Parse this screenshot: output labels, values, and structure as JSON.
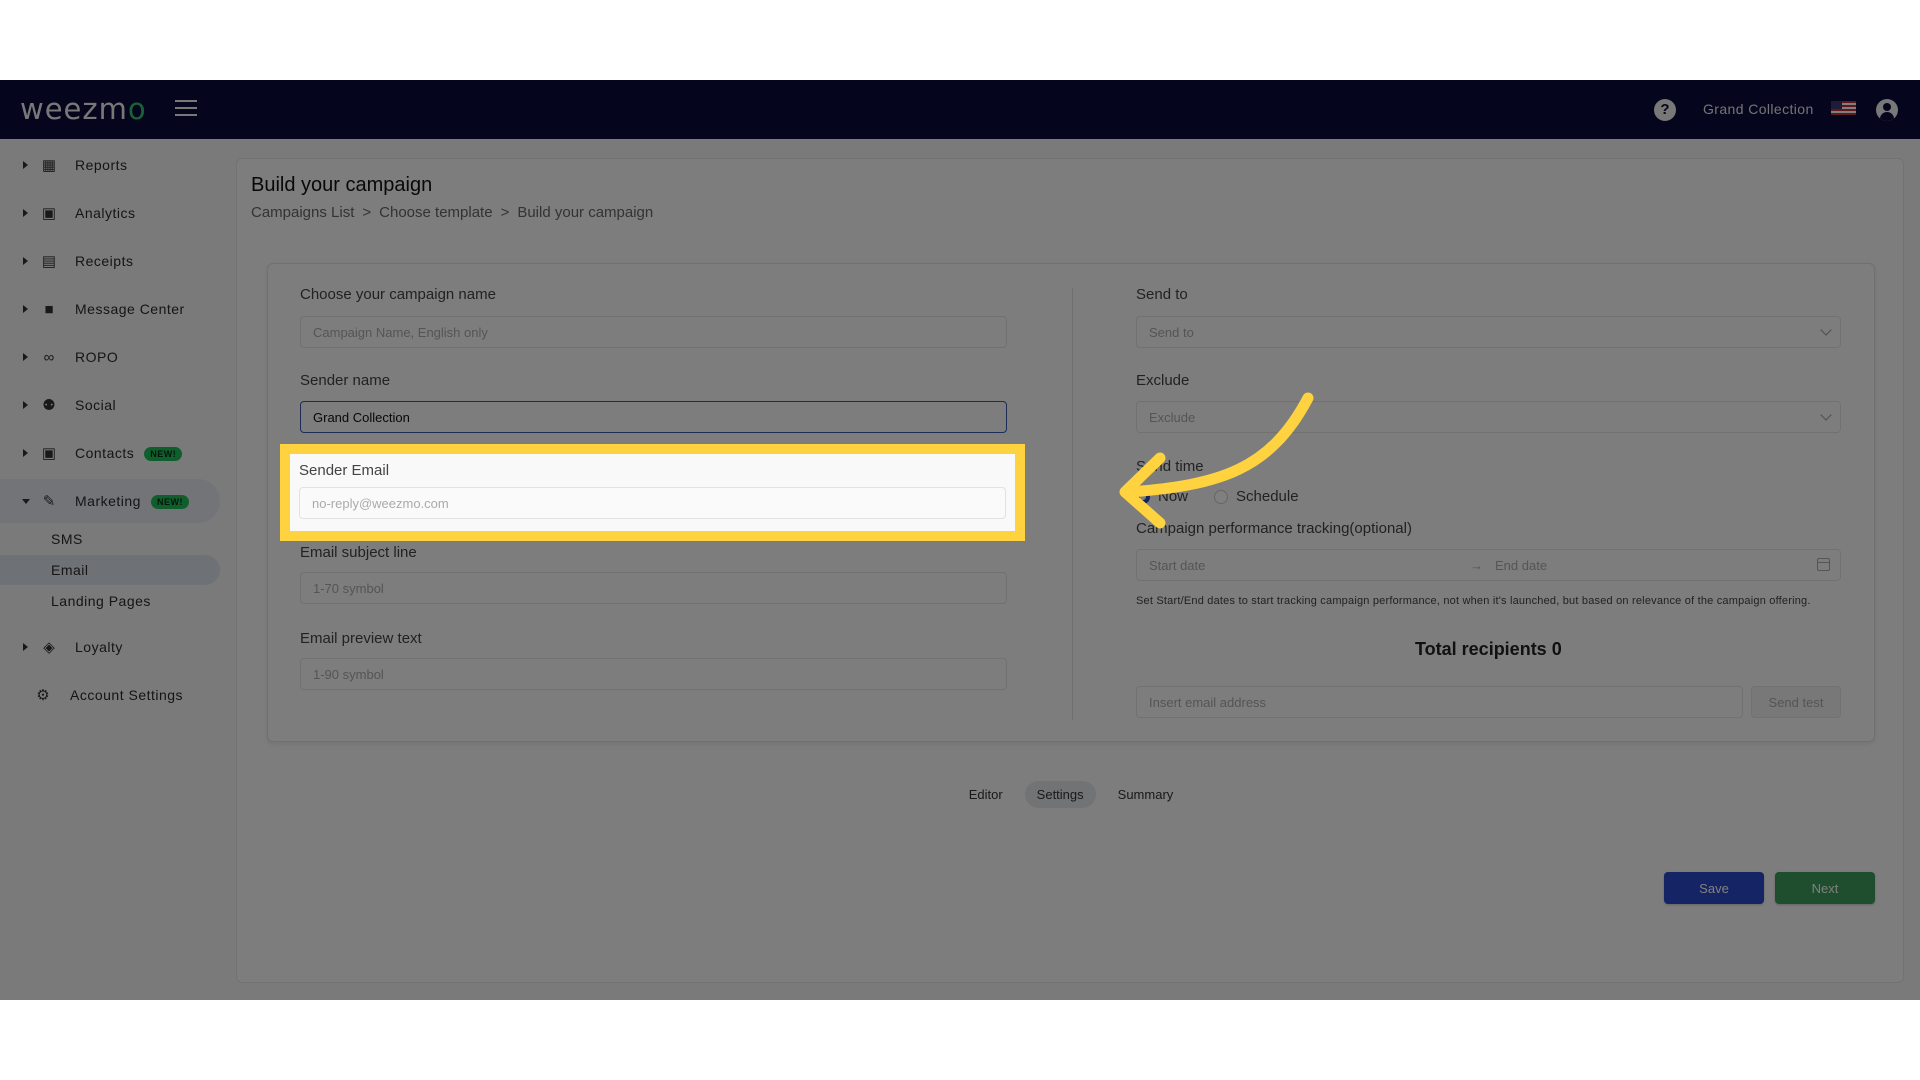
{
  "topbar": {
    "logo": "weezm",
    "logo_accent": "o",
    "account_name": "Grand Collection",
    "help_glyph": "?"
  },
  "sidebar": {
    "items": [
      {
        "label": "Reports",
        "icon": "dashboard-icon"
      },
      {
        "label": "Analytics",
        "icon": "bar-chart-icon"
      },
      {
        "label": "Receipts",
        "icon": "receipt-icon"
      },
      {
        "label": "Message Center",
        "icon": "chat-icon"
      },
      {
        "label": "ROPO",
        "icon": "infinity-icon"
      },
      {
        "label": "Social",
        "icon": "group-icon"
      },
      {
        "label": "Contacts",
        "icon": "contacts-icon",
        "badge": "NEW!"
      },
      {
        "label": "Marketing",
        "icon": "megaphone-icon",
        "badge": "NEW!",
        "expanded": true
      },
      {
        "label": "Loyalty",
        "icon": "tag-icon"
      },
      {
        "label": "Account Settings",
        "icon": "gear-icon"
      }
    ],
    "marketing_sub": [
      {
        "label": "SMS"
      },
      {
        "label": "Email",
        "active": true
      },
      {
        "label": "Landing Pages"
      }
    ]
  },
  "page": {
    "title": "Build your campaign",
    "breadcrumb": [
      "Campaigns List",
      "Choose template",
      "Build your campaign"
    ],
    "breadcrumb_sep": ">"
  },
  "form": {
    "campaign_name": {
      "label": "Choose your campaign name",
      "placeholder": "Campaign Name, English only",
      "value": ""
    },
    "sender_name": {
      "label": "Sender name",
      "value": "Grand Collection"
    },
    "sender_email": {
      "label": "Sender Email",
      "placeholder": "no-reply@weezmo.com",
      "value": ""
    },
    "subject": {
      "label": "Email subject line",
      "placeholder": "1-70 symbol",
      "value": ""
    },
    "preview": {
      "label": "Email preview text",
      "placeholder": "1-90 symbol",
      "value": ""
    },
    "send_to": {
      "label": "Send to",
      "placeholder": "Send to"
    },
    "exclude": {
      "label": "Exclude",
      "placeholder": "Exclude"
    },
    "send_time": {
      "label": "Send time",
      "options": [
        "Now",
        "Schedule"
      ],
      "selected": "Now"
    },
    "tracking": {
      "label": "Campaign performance tracking(optional)",
      "start_placeholder": "Start date",
      "end_placeholder": "End date",
      "arrow": "→",
      "help": "Set Start/End dates to start tracking campaign performance, not when it's launched, but based on relevance of the campaign offering."
    },
    "total_recipients": "Total recipients 0",
    "test_email": {
      "placeholder": "Insert email address",
      "button": "Send test"
    }
  },
  "steps": [
    {
      "label": "Editor"
    },
    {
      "label": "Settings",
      "active": true
    },
    {
      "label": "Summary"
    }
  ],
  "actions": {
    "save": "Save",
    "next": "Next"
  },
  "colors": {
    "navbar": "#0b0a3a",
    "highlight": "#ffd23f",
    "save": "#2b49c8",
    "next": "#3c9d5b",
    "badge": "#1fbf5a"
  }
}
